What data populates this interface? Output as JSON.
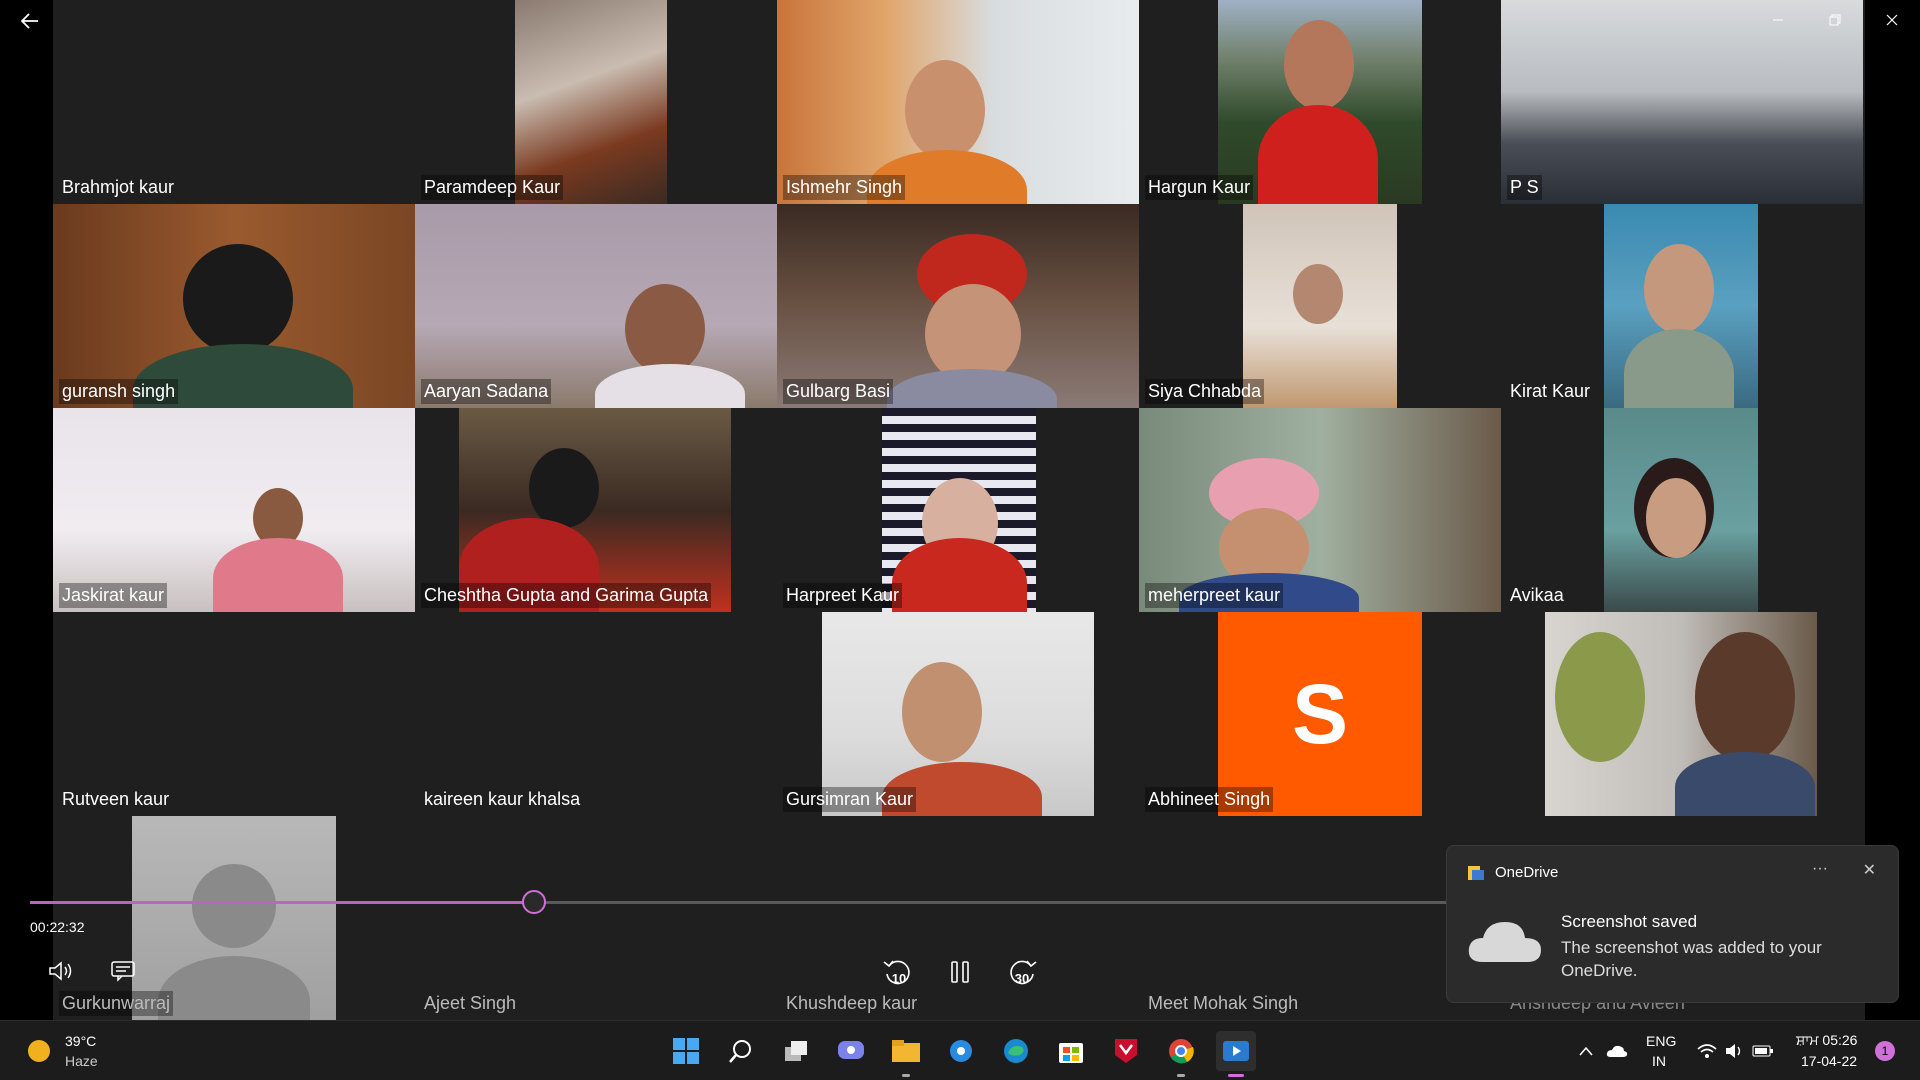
{
  "window": {
    "back_icon": "back-arrow-icon",
    "minimize_icon": "minimize-icon",
    "restore_icon": "restore-icon",
    "close_icon": "close-icon"
  },
  "participants": [
    {
      "name": "Brahmjot kaur"
    },
    {
      "name": "Paramdeep Kaur"
    },
    {
      "name": "Ishmehr Singh"
    },
    {
      "name": "Hargun Kaur"
    },
    {
      "name": "P S"
    },
    {
      "name": "guransh singh"
    },
    {
      "name": "Aaryan Sadana"
    },
    {
      "name": "Gulbarg Basi"
    },
    {
      "name": "Siya Chhabda"
    },
    {
      "name": "Kirat Kaur"
    },
    {
      "name": "Jaskirat kaur"
    },
    {
      "name": "Cheshtha Gupta and Garima Gupta"
    },
    {
      "name": "Harpreet Kaur"
    },
    {
      "name": "meherpreet kaur"
    },
    {
      "name": "Avikaa"
    },
    {
      "name": "Rutveen kaur"
    },
    {
      "name": "kaireen kaur khalsa"
    },
    {
      "name": "Gursimran Kaur"
    },
    {
      "name": "Abhineet Singh",
      "avatar_letter": "S",
      "avatar_color": "#ff5a00"
    },
    {
      "name": ""
    },
    {
      "name": "Gurkunwarraj"
    },
    {
      "name": "Ajeet Singh"
    },
    {
      "name": "Khushdeep kaur"
    },
    {
      "name": "Meet Mohak Singh"
    },
    {
      "name": "Anshdeep and Avleen"
    }
  ],
  "player": {
    "current_time": "00:22:32",
    "progress_fraction": 0.355,
    "rewind_label": "10",
    "forward_label": "30",
    "accent_color": "#c060c8"
  },
  "toast": {
    "app_name": "OneDrive",
    "title": "Screenshot saved",
    "body": "The screenshot was added to your OneDrive.",
    "more_label": "···",
    "close_label": "✕"
  },
  "taskbar": {
    "weather_temp": "39°C",
    "weather_desc": "Haze",
    "lang_top": "ENG",
    "lang_bottom": "IN",
    "time": "ਸ਼ਾਮ 05:26",
    "date": "17-04-22",
    "notification_count": "1",
    "pinned": [
      "start-icon",
      "search-icon",
      "task-view-icon",
      "chat-icon",
      "file-explorer-icon",
      "settings-icon",
      "edge-icon",
      "store-icon",
      "mcafee-icon",
      "chrome-icon",
      "media-player-icon"
    ]
  }
}
